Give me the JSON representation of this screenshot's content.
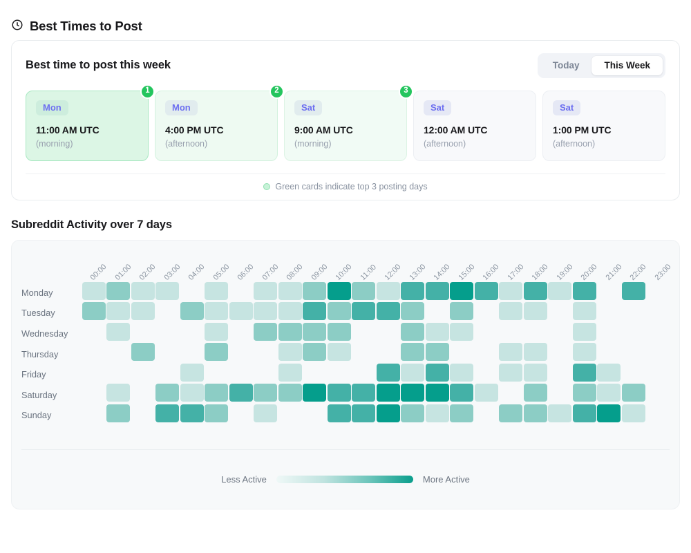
{
  "section": {
    "title": "Best Times to Post",
    "icon": "clock-icon"
  },
  "panel": {
    "title": "Best time to post this week",
    "toggle": {
      "options": [
        "Today",
        "This Week"
      ],
      "selected": "This Week"
    },
    "cards": [
      {
        "day": "Mon",
        "time": "11:00 AM UTC",
        "part": "(morning)",
        "rank": "1",
        "highlight": "rank1"
      },
      {
        "day": "Mon",
        "time": "4:00 PM UTC",
        "part": "(afternoon)",
        "rank": "2",
        "highlight": "rank2"
      },
      {
        "day": "Sat",
        "time": "9:00 AM UTC",
        "part": "(morning)",
        "rank": "3",
        "highlight": "rank3"
      },
      {
        "day": "Sat",
        "time": "12:00 AM UTC",
        "part": "(afternoon)",
        "rank": "",
        "highlight": ""
      },
      {
        "day": "Sat",
        "time": "1:00 PM UTC",
        "part": "(afternoon)",
        "rank": "",
        "highlight": ""
      }
    ],
    "footer_note": "Green cards indicate top 3 posting days"
  },
  "heatmap": {
    "title": "Subreddit Activity over 7 days",
    "legend": {
      "low_label": "Less Active",
      "high_label": "More Active"
    },
    "colors": {
      "level0": "transparent",
      "level1": "#c6e4e1",
      "level2": "#8ccdc5",
      "level3": "#44b1a7",
      "level4": "#059e8c",
      "panel_bg": "#f7f9fa",
      "accent": "#0a9e8c",
      "brand_green": "#24c55e",
      "chip_text": "#6d6ff0"
    }
  },
  "chart_data": {
    "type": "heatmap",
    "title": "Subreddit Activity over 7 days",
    "xlabel": "",
    "ylabel": "",
    "x": [
      "00:00",
      "01:00",
      "02:00",
      "03:00",
      "04:00",
      "05:00",
      "06:00",
      "07:00",
      "08:00",
      "09:00",
      "10:00",
      "11:00",
      "12:00",
      "13:00",
      "14:00",
      "15:00",
      "16:00",
      "17:00",
      "18:00",
      "19:00",
      "20:00",
      "21:00",
      "22:00",
      "23:00"
    ],
    "y": [
      "Monday",
      "Tuesday",
      "Wednesday",
      "Thursday",
      "Friday",
      "Saturday",
      "Sunday"
    ],
    "value_scale": [
      0,
      1,
      2,
      3,
      4
    ],
    "legend_low": "Less Active",
    "legend_high": "More Active",
    "values": [
      [
        1,
        2,
        1,
        1,
        0,
        1,
        0,
        1,
        1,
        2,
        4,
        2,
        1,
        3,
        3,
        4,
        3,
        1,
        3,
        1,
        3,
        0,
        3,
        0
      ],
      [
        2,
        1,
        1,
        0,
        2,
        1,
        1,
        1,
        1,
        3,
        2,
        3,
        3,
        2,
        0,
        2,
        0,
        1,
        1,
        0,
        1,
        0,
        0,
        0
      ],
      [
        0,
        1,
        0,
        0,
        0,
        1,
        0,
        2,
        2,
        2,
        2,
        0,
        0,
        2,
        1,
        1,
        0,
        0,
        0,
        0,
        1,
        0,
        0,
        0
      ],
      [
        0,
        0,
        2,
        0,
        0,
        2,
        0,
        0,
        1,
        2,
        1,
        0,
        0,
        2,
        2,
        0,
        0,
        1,
        1,
        0,
        1,
        0,
        0,
        0
      ],
      [
        0,
        0,
        0,
        0,
        1,
        0,
        0,
        0,
        1,
        0,
        0,
        0,
        3,
        1,
        3,
        1,
        0,
        1,
        1,
        0,
        3,
        1,
        0,
        0
      ],
      [
        0,
        1,
        0,
        2,
        1,
        2,
        3,
        2,
        2,
        4,
        3,
        3,
        4,
        4,
        4,
        3,
        1,
        0,
        2,
        0,
        2,
        1,
        2,
        0
      ],
      [
        0,
        2,
        0,
        3,
        3,
        2,
        0,
        1,
        0,
        0,
        3,
        3,
        4,
        2,
        1,
        2,
        0,
        2,
        2,
        1,
        3,
        4,
        1,
        0
      ]
    ]
  }
}
